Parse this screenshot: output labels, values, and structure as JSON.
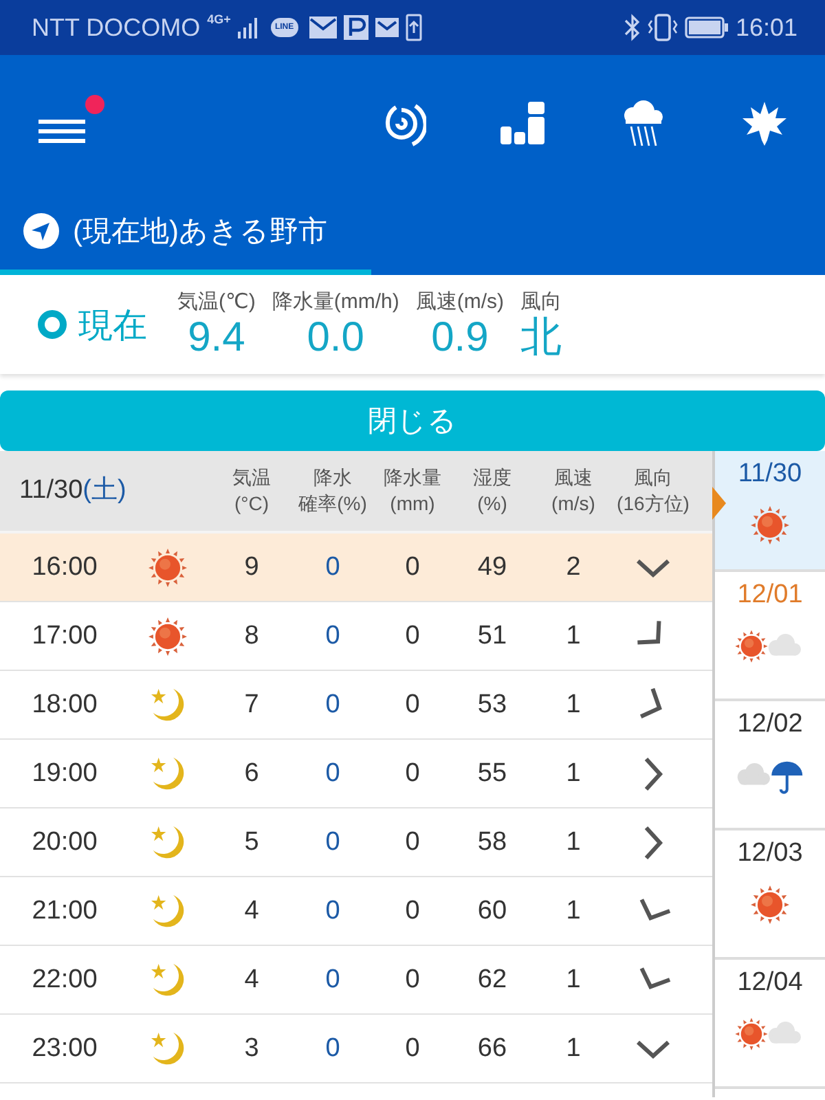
{
  "status_bar": {
    "carrier": "NTT DOCOMO",
    "network": "4G+",
    "line_badge": "LINE",
    "time": "16:01"
  },
  "header": {
    "menu_notification": true
  },
  "location": {
    "name": "(現在地)あきる野市",
    "selected": true
  },
  "current": {
    "label": "現在",
    "readings": [
      {
        "label": "気温(℃)",
        "value": "9.4"
      },
      {
        "label": "降水量(mm/h)",
        "value": "0.0"
      },
      {
        "label": "風速(m/s)",
        "value": "0.9"
      },
      {
        "label": "風向",
        "value": "北"
      }
    ]
  },
  "close_button": "閉じる",
  "table": {
    "date": "11/30",
    "weekday": "(土)",
    "columns": [
      {
        "lines": [
          "気温",
          "(°C)"
        ]
      },
      {
        "lines": [
          "降水",
          "確率(%)"
        ]
      },
      {
        "lines": [
          "降水量",
          "(mm)"
        ]
      },
      {
        "lines": [
          "湿度",
          "(%)"
        ]
      },
      {
        "lines": [
          "風速",
          "(m/s)"
        ]
      },
      {
        "lines": [
          "風向",
          "(16方位)"
        ]
      }
    ],
    "rows": [
      {
        "time": "16:00",
        "weather": {
          "kind": "sunny"
        },
        "temperature": "9",
        "precip_chance": "0",
        "precip_amount": "0",
        "humidity": "49",
        "wind_speed": "2",
        "wind_arrow": {
          "kind": "S"
        },
        "selected": true
      },
      {
        "time": "17:00",
        "weather": {
          "kind": "sunny"
        },
        "temperature": "8",
        "precip_chance": "0",
        "precip_amount": "0",
        "humidity": "51",
        "wind_speed": "1",
        "wind_arrow": {
          "kind": "SE"
        },
        "selected": false
      },
      {
        "time": "18:00",
        "weather": {
          "kind": "moon"
        },
        "temperature": "7",
        "precip_chance": "0",
        "precip_amount": "0",
        "humidity": "53",
        "wind_speed": "1",
        "wind_arrow": {
          "kind": "ESE"
        },
        "selected": false
      },
      {
        "time": "19:00",
        "weather": {
          "kind": "moon"
        },
        "temperature": "6",
        "precip_chance": "0",
        "precip_amount": "0",
        "humidity": "55",
        "wind_speed": "1",
        "wind_arrow": {
          "kind": "E"
        },
        "selected": false
      },
      {
        "time": "20:00",
        "weather": {
          "kind": "moon"
        },
        "temperature": "5",
        "precip_chance": "0",
        "precip_amount": "0",
        "humidity": "58",
        "wind_speed": "1",
        "wind_arrow": {
          "kind": "E"
        },
        "selected": false
      },
      {
        "time": "21:00",
        "weather": {
          "kind": "moon"
        },
        "temperature": "4",
        "precip_chance": "0",
        "precip_amount": "0",
        "humidity": "60",
        "wind_speed": "1",
        "wind_arrow": {
          "kind": "SSW"
        },
        "selected": false
      },
      {
        "time": "22:00",
        "weather": {
          "kind": "moon"
        },
        "temperature": "4",
        "precip_chance": "0",
        "precip_amount": "0",
        "humidity": "62",
        "wind_speed": "1",
        "wind_arrow": {
          "kind": "SSW"
        },
        "selected": false
      },
      {
        "time": "23:00",
        "weather": {
          "kind": "moon"
        },
        "temperature": "3",
        "precip_chance": "0",
        "precip_amount": "0",
        "humidity": "66",
        "wind_speed": "1",
        "wind_arrow": {
          "kind": "S"
        },
        "selected": false
      }
    ]
  },
  "days": [
    {
      "date": "11/30",
      "weather": {
        "kind": "sunny"
      },
      "selected": true,
      "color": "#1c5aa6"
    },
    {
      "date": "12/01",
      "weather": {
        "kind": "sunny_cloudy"
      },
      "selected": false,
      "color": "#e07b2a"
    },
    {
      "date": "12/02",
      "weather": {
        "kind": "cloudy_rain"
      },
      "selected": false,
      "color": "#333333"
    },
    {
      "date": "12/03",
      "weather": {
        "kind": "sunny"
      },
      "selected": false,
      "color": "#333333"
    },
    {
      "date": "12/04",
      "weather": {
        "kind": "sunny_cloudy"
      },
      "selected": false,
      "color": "#333333"
    }
  ]
}
